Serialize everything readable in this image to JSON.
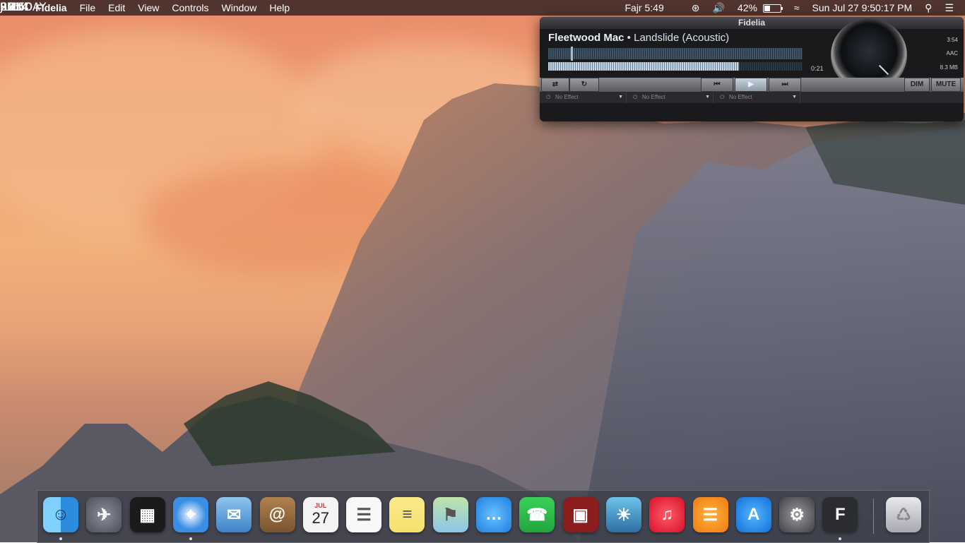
{
  "menubar": {
    "apple": "",
    "app_name": "Fidelia",
    "menus": [
      "File",
      "Edit",
      "View",
      "Controls",
      "Window",
      "Help"
    ],
    "prayer": "Fajr 5:49",
    "battery_percent": "42%",
    "battery_level": 0.42,
    "clock": "Sun Jul 27  9:50:17 PM"
  },
  "clock_widget": {
    "month": "JULY",
    "day": "27",
    "weekday": "SUNDAY",
    "year": "2014",
    "time": "09:50",
    "ampm": "PM"
  },
  "player": {
    "window_title": "Fidelia",
    "artist": "Fleetwood Mac",
    "separator": " • ",
    "title": "Landslide (Acoustic)",
    "elapsed": "0:21",
    "duration": "3:54",
    "format": "AAC",
    "size": "8.3 MB",
    "progress": 0.75,
    "buttons": {
      "dim": "DIM",
      "mute": "MUTE"
    },
    "effects": [
      "No Effect",
      "No Effect",
      "No Effect"
    ]
  },
  "dock": {
    "apps": [
      {
        "name": "Finder",
        "icon": "finder-icon",
        "running": true
      },
      {
        "name": "Launchpad",
        "icon": "launchpad-icon",
        "running": false
      },
      {
        "name": "Mission Control",
        "icon": "mission-control-icon",
        "running": false
      },
      {
        "name": "Safari",
        "icon": "safari-icon",
        "running": true
      },
      {
        "name": "Mail",
        "icon": "mail-icon",
        "running": false
      },
      {
        "name": "Contacts",
        "icon": "contacts-icon",
        "running": false
      },
      {
        "name": "Calendar",
        "icon": "calendar-icon",
        "running": false,
        "label_month": "JUL",
        "label_day": "27"
      },
      {
        "name": "Reminders",
        "icon": "reminders-icon",
        "running": false
      },
      {
        "name": "Notes",
        "icon": "notes-icon",
        "running": false
      },
      {
        "name": "Maps",
        "icon": "maps-icon",
        "running": false
      },
      {
        "name": "Messages",
        "icon": "messages-icon",
        "running": false
      },
      {
        "name": "FaceTime",
        "icon": "facetime-icon",
        "running": false
      },
      {
        "name": "Photo Booth",
        "icon": "photo-booth-icon",
        "running": false
      },
      {
        "name": "iPhoto",
        "icon": "iphoto-icon",
        "running": false
      },
      {
        "name": "iTunes",
        "icon": "itunes-icon",
        "running": false
      },
      {
        "name": "iBooks",
        "icon": "ibooks-icon",
        "running": false
      },
      {
        "name": "App Store",
        "icon": "app-store-icon",
        "running": false
      },
      {
        "name": "System Preferences",
        "icon": "system-preferences-icon",
        "running": false
      },
      {
        "name": "Fidelia",
        "icon": "fidelia-icon",
        "running": true
      }
    ],
    "trash": {
      "name": "Trash",
      "icon": "trash-icon"
    }
  },
  "colors": {
    "menubar_bg": "#2c1c1e",
    "player_bg": "#1a1a1c",
    "accent_blue": "#d6e3f0"
  }
}
